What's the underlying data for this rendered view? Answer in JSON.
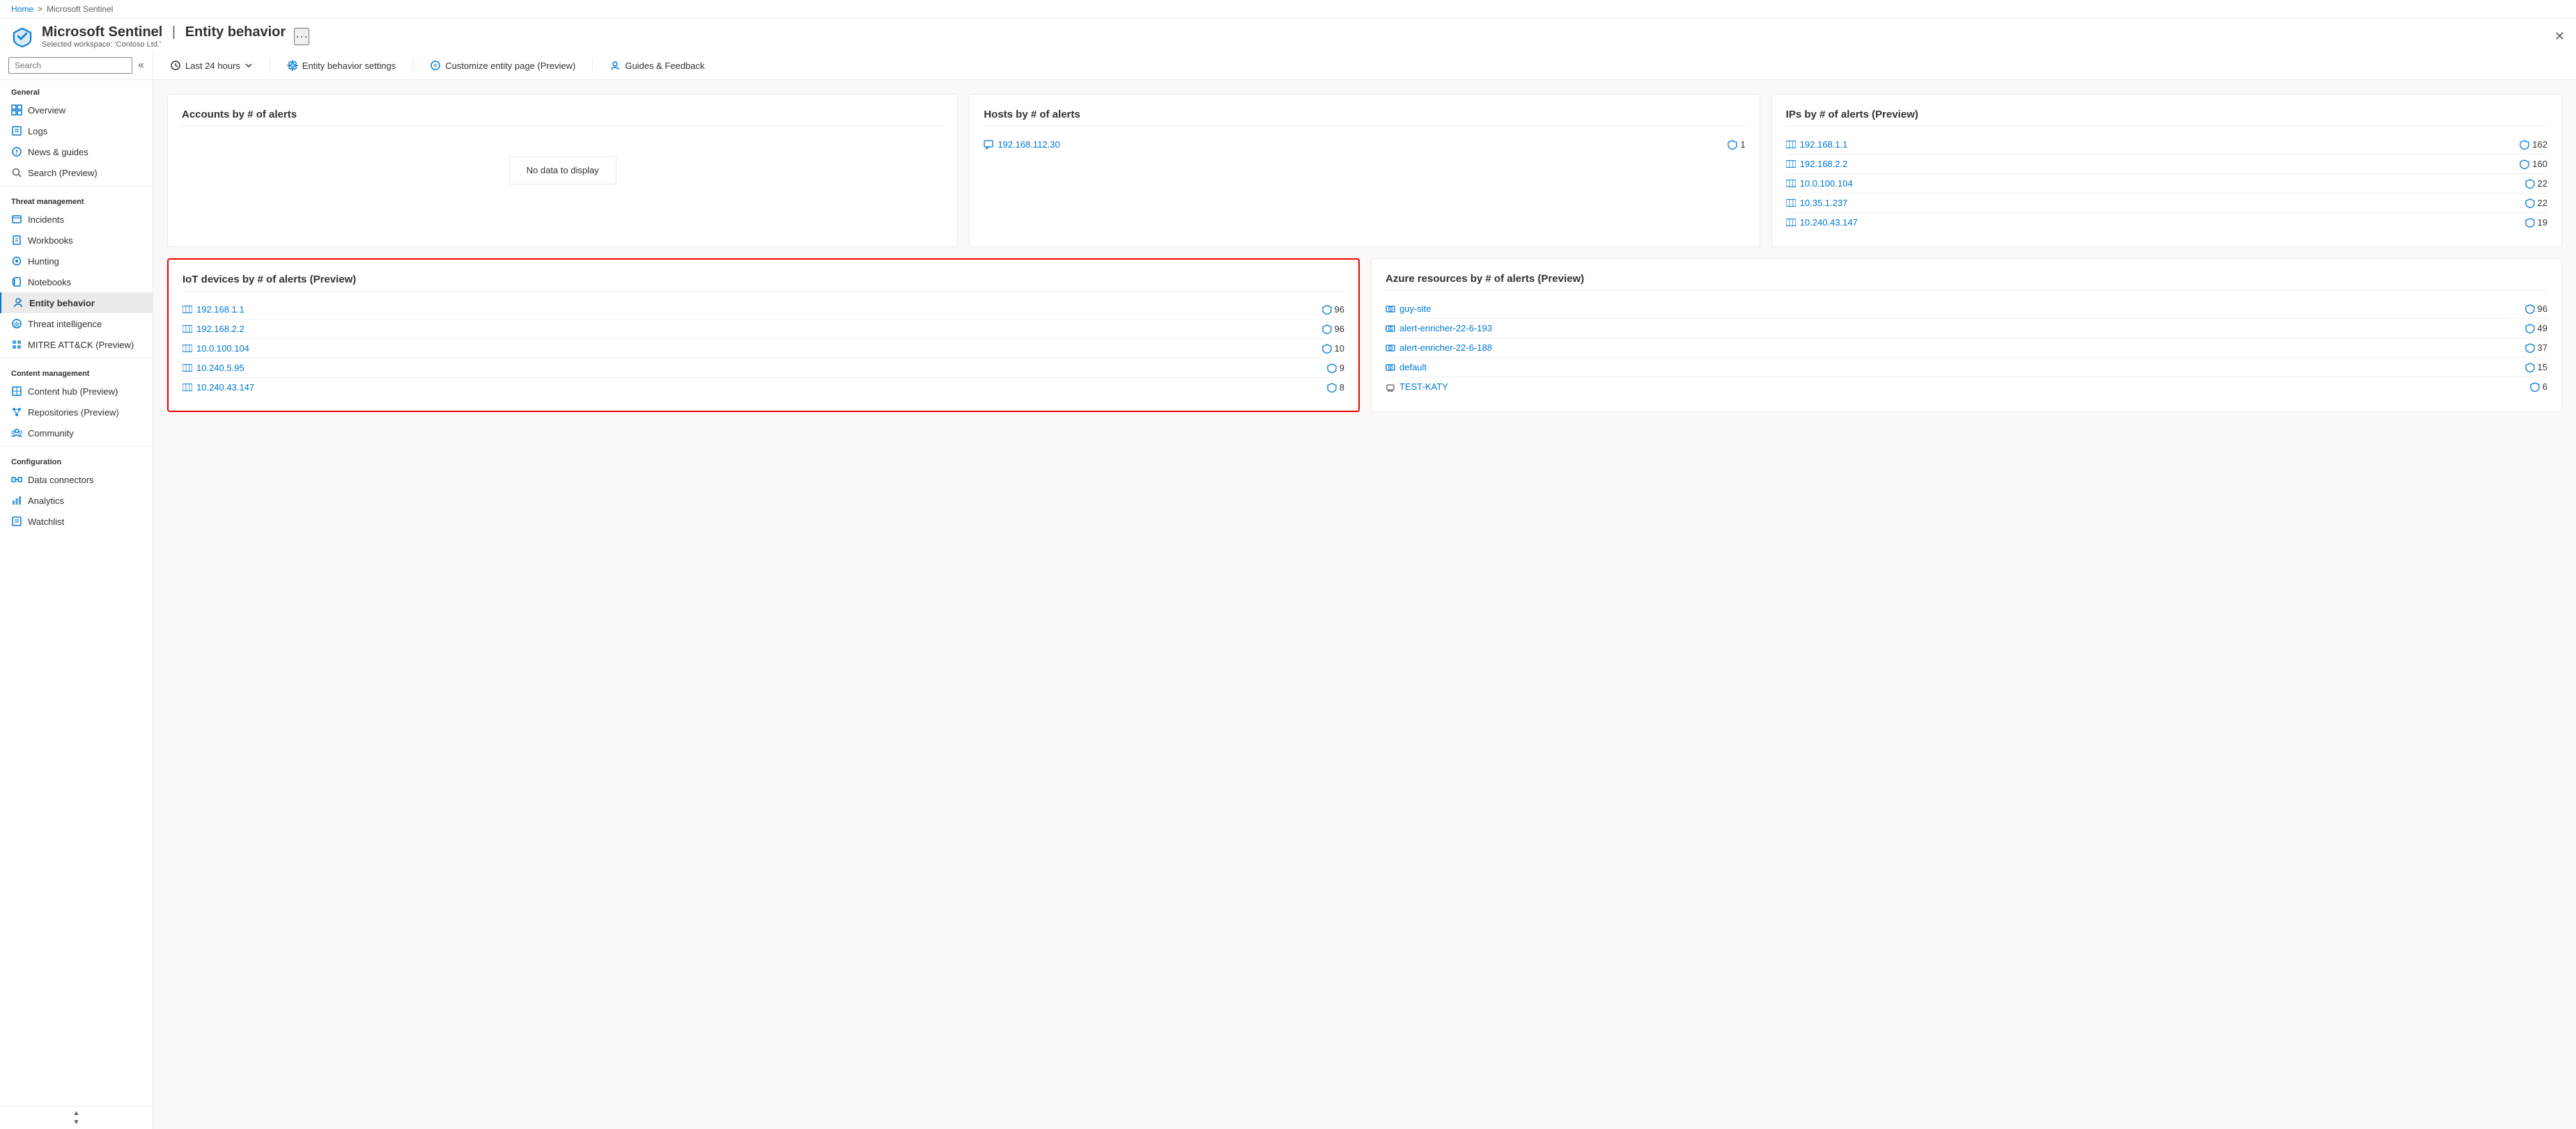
{
  "breadcrumb": {
    "home": "Home",
    "sep": ">",
    "current": "Microsoft Sentinel"
  },
  "titlebar": {
    "app": "Microsoft Sentinel",
    "separator": "|",
    "page": "Entity behavior",
    "workspace_label": "Selected workspace: 'Contoso Ltd.'"
  },
  "sidebar": {
    "search_placeholder": "Search",
    "collapse_icon": "«",
    "sections": [
      {
        "label": "General",
        "items": [
          {
            "id": "overview",
            "label": "Overview",
            "icon": "grid"
          },
          {
            "id": "logs",
            "label": "Logs",
            "icon": "logs"
          },
          {
            "id": "news-guides",
            "label": "News & guides",
            "icon": "news"
          },
          {
            "id": "search-preview",
            "label": "Search (Preview)",
            "icon": "search"
          }
        ]
      },
      {
        "label": "Threat management",
        "items": [
          {
            "id": "incidents",
            "label": "Incidents",
            "icon": "incidents"
          },
          {
            "id": "workbooks",
            "label": "Workbooks",
            "icon": "workbooks"
          },
          {
            "id": "hunting",
            "label": "Hunting",
            "icon": "hunting"
          },
          {
            "id": "notebooks",
            "label": "Notebooks",
            "icon": "notebooks"
          },
          {
            "id": "entity-behavior",
            "label": "Entity behavior",
            "icon": "entity",
            "active": true
          },
          {
            "id": "threat-intelligence",
            "label": "Threat intelligence",
            "icon": "threat"
          },
          {
            "id": "mitre-attack",
            "label": "MITRE ATT&CK (Preview)",
            "icon": "mitre"
          }
        ]
      },
      {
        "label": "Content management",
        "items": [
          {
            "id": "content-hub",
            "label": "Content hub (Preview)",
            "icon": "hub"
          },
          {
            "id": "repositories",
            "label": "Repositories (Preview)",
            "icon": "repo"
          },
          {
            "id": "community",
            "label": "Community",
            "icon": "community"
          }
        ]
      },
      {
        "label": "Configuration",
        "items": [
          {
            "id": "data-connectors",
            "label": "Data connectors",
            "icon": "connectors"
          },
          {
            "id": "analytics",
            "label": "Analytics",
            "icon": "analytics"
          },
          {
            "id": "watchlist",
            "label": "Watchlist",
            "icon": "watchlist"
          }
        ]
      }
    ]
  },
  "toolbar": {
    "time_range": "Last 24 hours",
    "settings_btn": "Entity behavior settings",
    "customize_btn": "Customize entity page (Preview)",
    "guides_btn": "Guides & Feedback"
  },
  "cards": {
    "row1": [
      {
        "id": "accounts",
        "title": "Accounts by # of alerts",
        "items": [],
        "no_data": "No data to display",
        "show_no_data": true
      },
      {
        "id": "hosts",
        "title": "Hosts by # of alerts",
        "items": [
          {
            "ip": "192.168.112.30",
            "count": 1
          }
        ],
        "show_no_data": false
      },
      {
        "id": "ips",
        "title": "IPs by # of alerts (Preview)",
        "items": [
          {
            "ip": "192.168.1.1",
            "count": 162
          },
          {
            "ip": "192.168.2.2",
            "count": 160
          },
          {
            "ip": "10.0.100.104",
            "count": 22
          },
          {
            "ip": "10.35.1.237",
            "count": 22
          },
          {
            "ip": "10.240.43.147",
            "count": 19
          }
        ],
        "show_no_data": false
      }
    ],
    "row2": [
      {
        "id": "iot-devices",
        "title": "IoT devices by # of alerts (Preview)",
        "highlighted": true,
        "items": [
          {
            "ip": "192.168.1.1",
            "count": 96
          },
          {
            "ip": "192.168.2.2",
            "count": 96
          },
          {
            "ip": "10.0.100.104",
            "count": 10
          },
          {
            "ip": "10.240.5.95",
            "count": 9
          },
          {
            "ip": "10.240.43.147",
            "count": 8
          }
        ],
        "show_no_data": false
      },
      {
        "id": "azure-resources",
        "title": "Azure resources by # of alerts (Preview)",
        "highlighted": false,
        "items": [
          {
            "ip": "guy-site",
            "count": 96,
            "type": "site"
          },
          {
            "ip": "alert-enricher-22-6-193",
            "count": 49,
            "type": "resource"
          },
          {
            "ip": "alert-enricher-22-6-188",
            "count": 37,
            "type": "resource"
          },
          {
            "ip": "default",
            "count": 15,
            "type": "resource"
          },
          {
            "ip": "TEST-KATY",
            "count": 6,
            "type": "vm"
          }
        ],
        "show_no_data": false
      }
    ]
  }
}
